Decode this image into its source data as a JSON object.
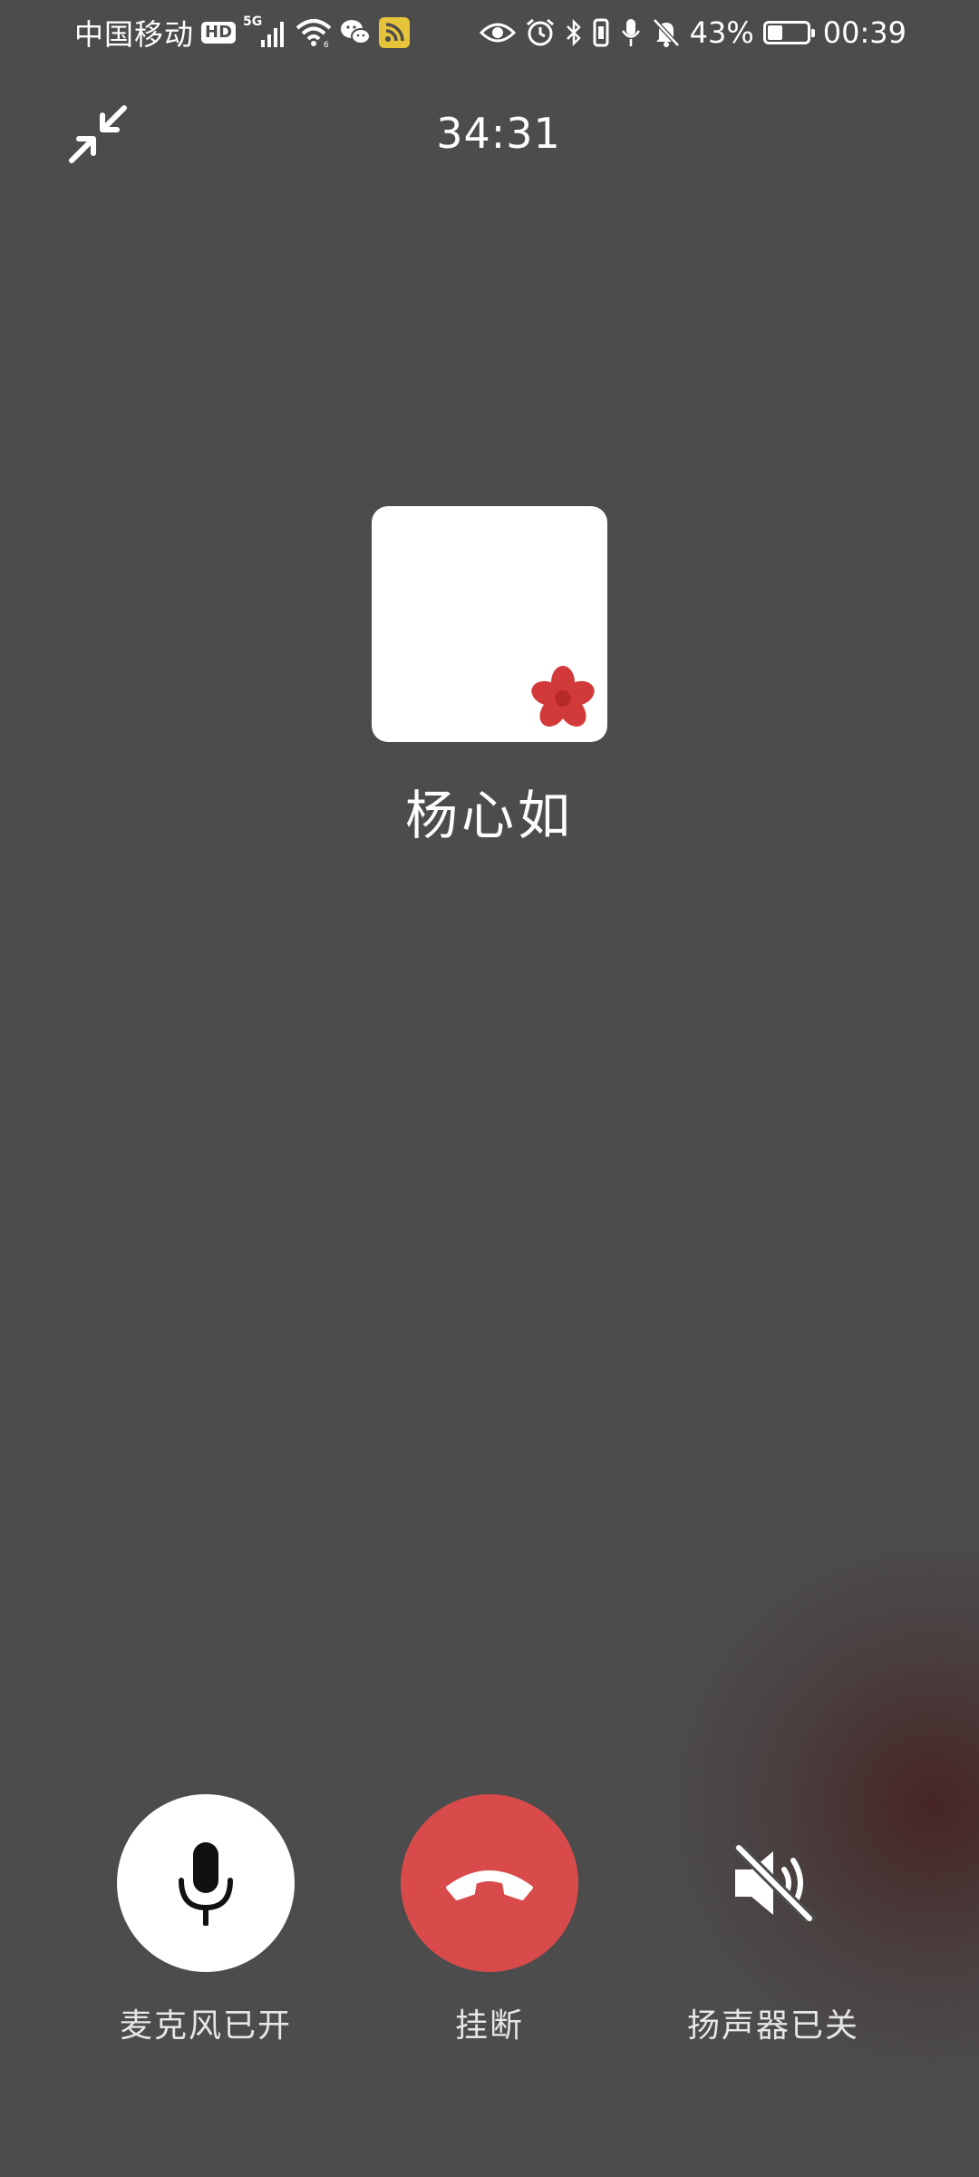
{
  "status_bar": {
    "carrier": "中国移动",
    "hd_label": "HD",
    "network_type": "5G",
    "battery_percent": "43%",
    "battery_level": 0.43,
    "time": "00:39",
    "rss_badge_color": "#e6c43a",
    "icons": [
      "hd-icon",
      "signal-icon",
      "wifi-icon",
      "wechat-icon",
      "rss-icon",
      "eye-icon",
      "alarm-icon",
      "bluetooth-icon",
      "vibrate-icon",
      "microphone-icon",
      "bell-muted-icon",
      "battery-icon"
    ]
  },
  "call": {
    "timer": "34:31",
    "minimize_icon": "minimize-icon"
  },
  "contact": {
    "name": "杨心如",
    "avatar_icon": "red-flower-icon",
    "avatar_background": "#ffffff"
  },
  "controls": {
    "microphone": {
      "label": "麦克风已开",
      "icon": "microphone-icon",
      "state": "on"
    },
    "hangup": {
      "label": "挂断",
      "icon": "hang-up-icon",
      "color": "#d94b4b"
    },
    "speaker": {
      "label": "扬声器已关",
      "icon": "speaker-muted-icon",
      "state": "off"
    }
  },
  "colors": {
    "background": "#4c4c4c",
    "hangup": "#d94b4b",
    "text": "#ffffff"
  }
}
